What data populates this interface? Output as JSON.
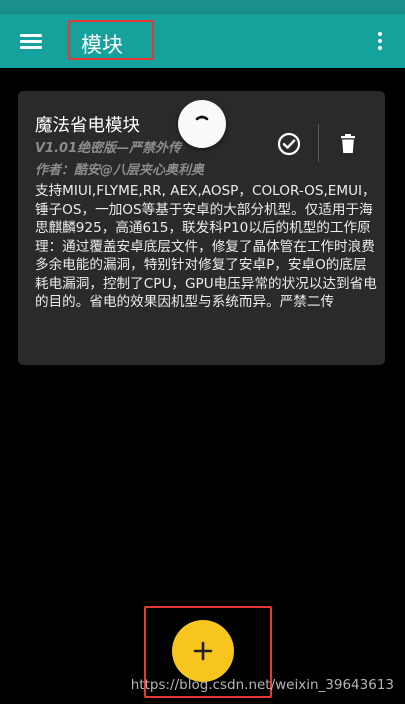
{
  "app_bar": {
    "title": "模块"
  },
  "module": {
    "name": "魔法省电模块",
    "version": "V1.01绝密版—严禁外传",
    "author": "作者：酷安@八层夹心奥利奥",
    "description": "支持MIUI,FLYME,RR, AEX,AOSP，COLOR-OS,EMUI，锤子OS，一加OS等基于安卓的大部分机型。仅适用于海思麒麟925，高通615，联发科P10以后的机型的工作原理：通过覆盖安卓底层文件，修复了晶体管在工作时浪费多余电能的漏洞，特别针对修复了安卓P，安卓O的底层耗电漏洞，控制了CPU，GPU电压异常的状况以达到省电的目的。省电的效果因机型与系统而异。严禁二传"
  },
  "fab": {
    "icon": "plus-icon"
  },
  "watermark": "https://blog.csdn.net/weixin_39643613",
  "colors": {
    "app_bar": "#15a29d",
    "card": "#2a2a2a",
    "fab": "#f7c51d",
    "highlight": "#e53935"
  }
}
